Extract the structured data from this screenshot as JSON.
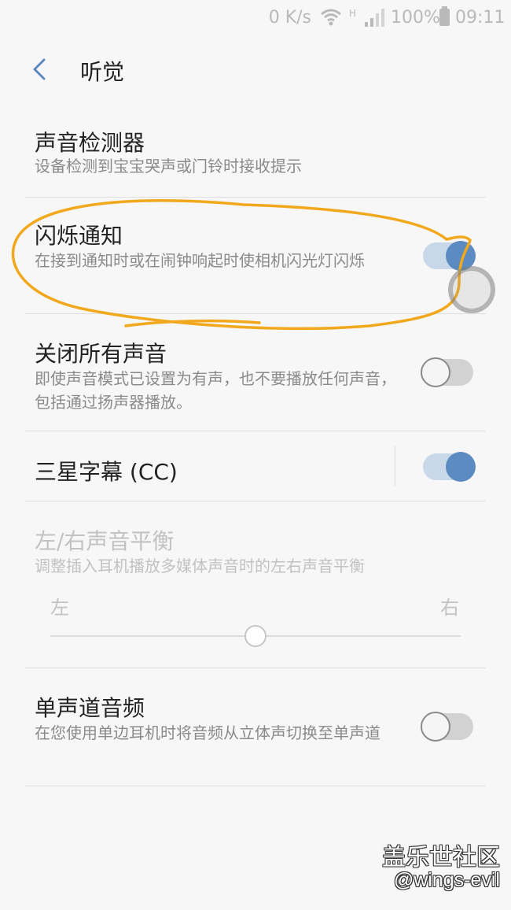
{
  "status_bar": {
    "network_speed": "0 K/s",
    "network_type": "H",
    "battery_percent": "100%",
    "time": "09:11"
  },
  "header": {
    "title": "听觉"
  },
  "settings": [
    {
      "title": "声音检测器",
      "description": "设备检测到宝宝哭声或门铃时接收提示"
    },
    {
      "title": "闪烁通知",
      "description": "在接到通知时或在闹钟响起时使相机闪光灯闪烁",
      "toggle": true
    },
    {
      "title": "关闭所有声音",
      "description": "即使声音模式已设置为有声，也不要播放任何声音，包括通过扬声器播放。",
      "toggle": false
    },
    {
      "title": "三星字幕 (CC)",
      "toggle": true
    },
    {
      "title": "左/右声音平衡",
      "description": "调整插入耳机播放多媒体声音时的左右声音平衡",
      "left_label": "左",
      "right_label": "右",
      "balance_value": 0.5,
      "enabled": false
    },
    {
      "title": "单声道音频",
      "description": "在您使用单边耳机时将音频从立体声切换至单声道",
      "toggle": false
    }
  ],
  "watermark": {
    "line1": "盖乐世社区",
    "line2": "@wings-evil"
  },
  "colors": {
    "background": "#f7f7f7",
    "accent": "#5b8bc1",
    "annotation": "#f2a81d"
  }
}
